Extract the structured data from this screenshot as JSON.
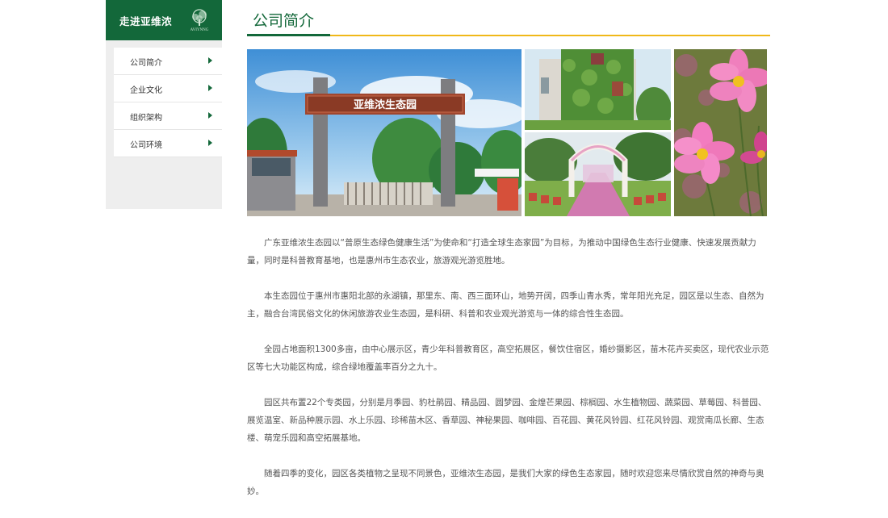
{
  "sidebar": {
    "title": "走进亚维浓",
    "logo_text": "AVIYNNG",
    "items": [
      {
        "label": "公司简介"
      },
      {
        "label": "企业文化"
      },
      {
        "label": "组织架构"
      },
      {
        "label": "公司环境"
      }
    ]
  },
  "main": {
    "title": "公司简介",
    "gate_sign": "亚维浓生态园",
    "paragraphs": [
      "广东亚维浓生态园以“普原生态绿色健康生活”为使命和“打造全球生态家园”为目标，为推动中国绿色生态行业健康、快速发展贡献力量，同时是科普教育基地，也是惠州市生态农业，旅游观光游览胜地。",
      "本生态园位于惠州市惠阳北部的永湖镇，那里东、南、西三面环山，地势开阔，四季山青水秀，常年阳光充足，园区是以生态、自然为主，融合台湾民俗文化的休闲旅游农业生态园，是科研、科普和农业观光游览与一体的综合性生态园。",
      "全园占地面积1300多亩，由中心展示区，青少年科普教育区，高空拓展区，餐饮住宿区，婚纱摄影区，苗木花卉买卖区，现代农业示范区等七大功能区构成，综合绿地覆盖率百分之九十。",
      "园区共布置22个专类园，分别是月季园、豹杜鹃园、精品园、圆梦园、金煌芒果园、棕榈园、水生植物园、蔬菜园、草莓园、科普园、展览温室、新品种展示园、水上乐园、珍稀苗木区、香草园、神秘果园、咖啡园、百花园、黄花风铃园、红花风铃园、观赏南瓜长廊、生态楼、萌宠乐园和高空拓展基地。",
      "随着四季的变化，园区各类植物之呈现不同景色，亚维浓生态园，是我们大家的绿色生态家园，随时欢迎您来尽情欣赏自然的神奇与奥妙。"
    ]
  },
  "colors": {
    "brand_green": "#13683a",
    "accent_yellow": "#f0b819"
  }
}
